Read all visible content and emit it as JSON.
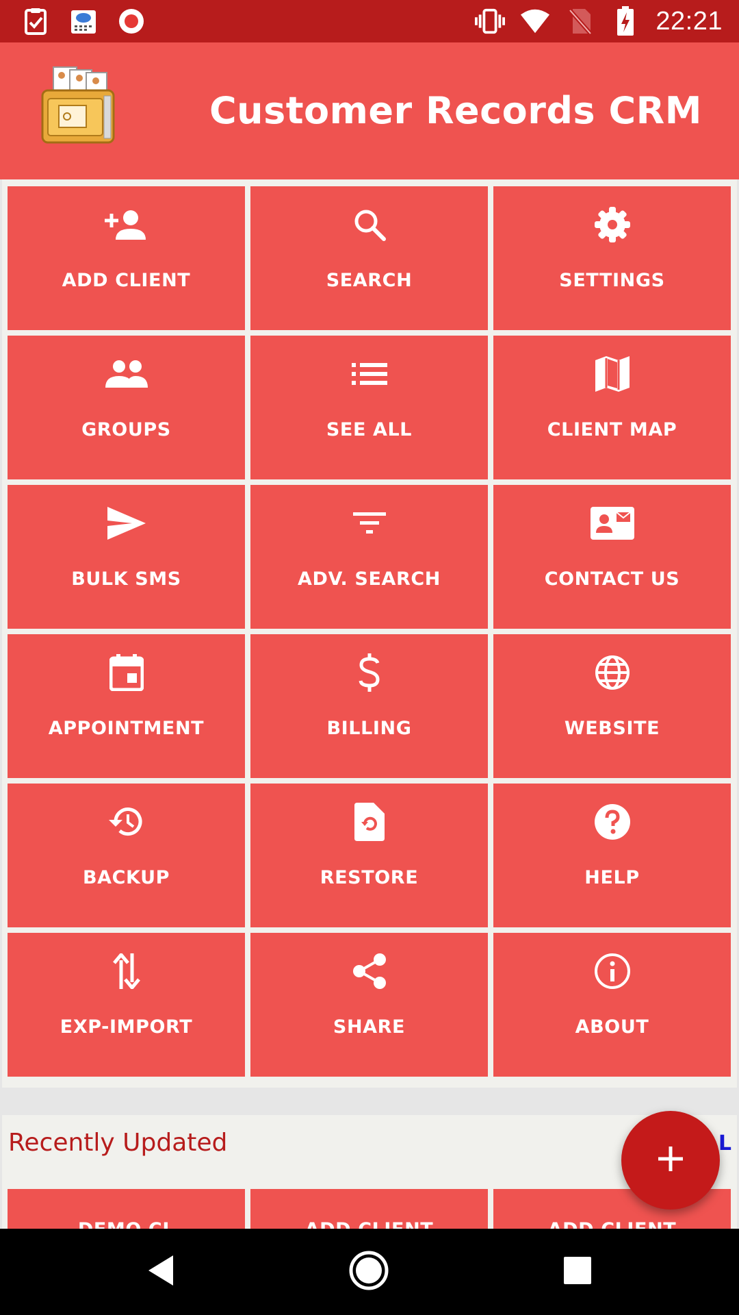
{
  "status_bar": {
    "time": "22:21",
    "left_icons": [
      "clipboard-check-icon",
      "weather-app-icon",
      "record-icon"
    ],
    "right_icons": [
      "vibrate-icon",
      "wifi-icon",
      "no-sim-icon",
      "battery-charging-icon"
    ]
  },
  "app_bar": {
    "title": "Customer Records CRM",
    "logo_icon": "crm-folder-logo"
  },
  "menu": {
    "tiles": [
      {
        "label": "ADD CLIENT",
        "icon": "person-add-icon"
      },
      {
        "label": "SEARCH",
        "icon": "search-icon"
      },
      {
        "label": "SETTINGS",
        "icon": "gear-icon"
      },
      {
        "label": "GROUPS",
        "icon": "group-icon"
      },
      {
        "label": "SEE ALL",
        "icon": "list-icon"
      },
      {
        "label": "CLIENT MAP",
        "icon": "map-icon"
      },
      {
        "label": "BULK SMS",
        "icon": "send-icon"
      },
      {
        "label": "ADV. SEARCH",
        "icon": "filter-icon"
      },
      {
        "label": "CONTACT US",
        "icon": "contact-card-icon"
      },
      {
        "label": "APPOINTMENT",
        "icon": "calendar-icon"
      },
      {
        "label": "BILLING",
        "icon": "dollar-icon"
      },
      {
        "label": "WEBSITE",
        "icon": "globe-icon"
      },
      {
        "label": "BACKUP",
        "icon": "backup-icon"
      },
      {
        "label": "RESTORE",
        "icon": "restore-file-icon"
      },
      {
        "label": "HELP",
        "icon": "help-icon"
      },
      {
        "label": "EXP-IMPORT",
        "icon": "swap-vertical-icon"
      },
      {
        "label": "SHARE",
        "icon": "share-icon"
      },
      {
        "label": "ABOUT",
        "icon": "info-icon"
      }
    ]
  },
  "recent": {
    "title": "Recently Updated",
    "see_all_label": "L",
    "items": [
      "DEMO CL",
      "ADD CLIENT",
      "ADD CLIENT"
    ]
  },
  "fab": {
    "icon": "plus-icon"
  },
  "nav_bar": {
    "buttons": [
      "back-icon",
      "home-icon",
      "recents-icon"
    ]
  },
  "colors": {
    "status_bar": "#b71c1c",
    "accent": "#ef5350",
    "fab": "#c41a1a",
    "recent_title": "#b71c1c",
    "link": "#1a1ad6"
  }
}
